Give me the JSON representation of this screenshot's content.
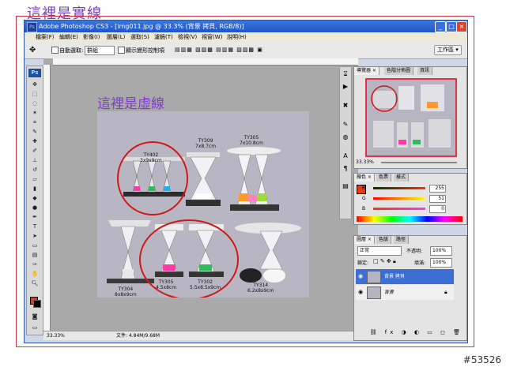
{
  "annotations": {
    "top_label": "這裡是實線",
    "canvas_label": "這裡是虛線",
    "watermark": "#53526"
  },
  "window": {
    "title": "Adobe Photoshop CS3 - [img011.jpg @ 33.3% (背景 拷貝, RGB/8)]",
    "app_icon": "Ps"
  },
  "menu": [
    "檔案(F)",
    "編輯(E)",
    "影像(I)",
    "圖層(L)",
    "選取(S)",
    "濾鏡(T)",
    "檢視(V)",
    "視窗(W)",
    "說明(H)"
  ],
  "options": {
    "auto_select_label": "自動選取:",
    "auto_select_value": "群組",
    "show_transform_label": "顯示變形控制項",
    "workspace_label": "工作區 ▾"
  },
  "canvas": {
    "products": [
      {
        "code": "TY402",
        "size": "3x9x9cm"
      },
      {
        "code": "TY309",
        "size": "7x8.7cm"
      },
      {
        "code": "TY305",
        "size": "7x10.8cm"
      },
      {
        "code": "TY304",
        "size": "8x8x9cm"
      },
      {
        "code": "TY305",
        "size": "4.5x8cm"
      },
      {
        "code": "TY302",
        "size": "5.5x8.5x9cm"
      },
      {
        "code": "TY314",
        "size": "6.2x8x9cm"
      }
    ]
  },
  "status": {
    "zoom": "33.33%",
    "doc": "文件: 4.84M/9.68M"
  },
  "navigator": {
    "tabs": [
      "導覽器 ×",
      "色階分佈圖",
      "資訊"
    ],
    "zoom": "33.33%"
  },
  "color_panel": {
    "tabs": [
      "顏色 ×",
      "色票",
      "樣式"
    ],
    "channels": [
      {
        "label": "R",
        "value": "255"
      },
      {
        "label": "G",
        "value": "51"
      },
      {
        "label": "B",
        "value": "0"
      }
    ],
    "fg_color": "#e43914"
  },
  "layers_panel": {
    "tabs": [
      "圖層 ×",
      "色版",
      "路徑"
    ],
    "blend_mode": "正常",
    "opacity_label": "不透明:",
    "opacity_value": "100%",
    "lock_label": "鎖定:",
    "fill_label": "填滿:",
    "fill_value": "100%",
    "layers": [
      {
        "name": "背景 拷貝",
        "selected": true
      },
      {
        "name": "背景",
        "selected": false
      }
    ]
  }
}
